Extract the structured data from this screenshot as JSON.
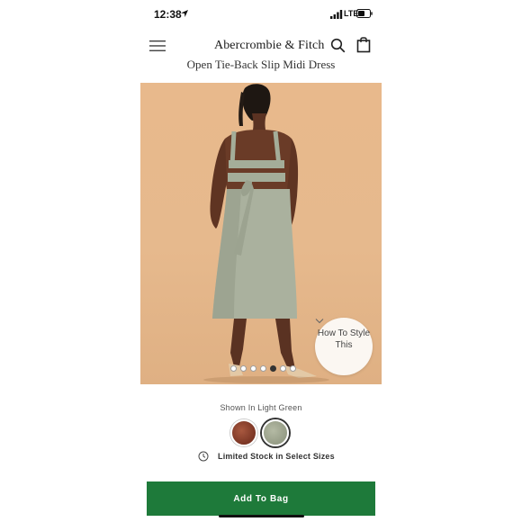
{
  "status_bar": {
    "time": "12:38",
    "network": "LTE"
  },
  "header": {
    "logo": "Abercrombie & Fitch",
    "icons": [
      "menu-icon",
      "search-icon",
      "bag-icon"
    ]
  },
  "product": {
    "title": "Open Tie-Back Slip Midi Dress",
    "image_count": 7,
    "active_image_index": 4,
    "how_to": "How To Style This",
    "shown_in": "Shown In Light Green",
    "swatches": [
      {
        "name": "brown",
        "color": "#8a402b",
        "selected": false
      },
      {
        "name": "light-green",
        "color": "#a3a992",
        "selected": true
      }
    ],
    "stock_message": "Limited Stock in Select Sizes"
  },
  "actions": {
    "add_to_bag": "Add To Bag"
  },
  "colors": {
    "brand_green": "#1e7a3a",
    "image_background": "#e6b98d"
  }
}
